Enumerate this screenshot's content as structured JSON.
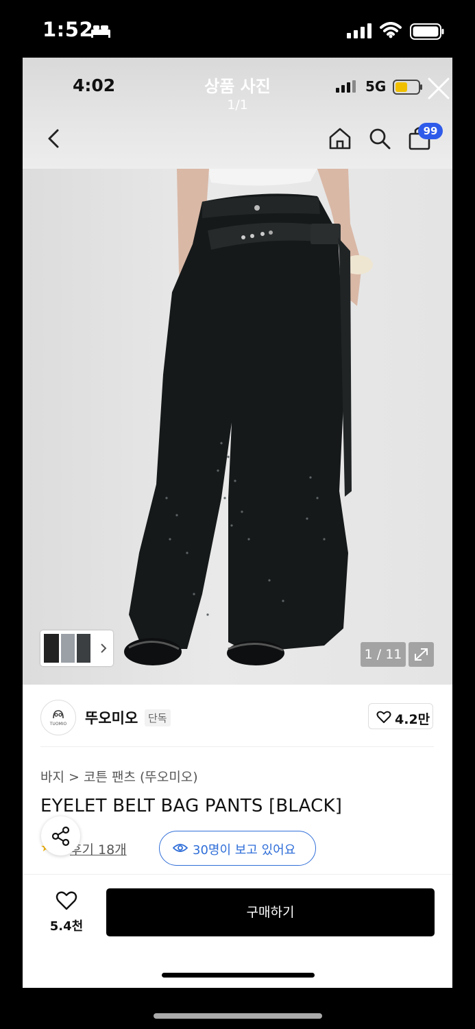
{
  "outer_status": {
    "time": "1:52"
  },
  "viewer": {
    "inner_time": "4:02",
    "title": "상품 사진",
    "count": "1/1",
    "network": "5G",
    "cart_badge": "99"
  },
  "product": {
    "image_page": "1 / 11",
    "brand": {
      "name": "뚜오미오",
      "logo_text": "TUOMIO",
      "badge": "단독",
      "likes": "4.2만"
    },
    "breadcrumb": "바지 > 코튼 팬츠 (뚜오미오)",
    "title": "EYELET BELT BAG PANTS [BLACK]",
    "review_link": "후기 18개",
    "viewer_notice": "30명이 보고 있어요"
  },
  "bottom_bar": {
    "wish_count": "5.4천",
    "buy_label": "구매하기"
  },
  "colors": {
    "accent_blue": "#2f6ed8",
    "badge_blue": "#2f5bea",
    "star": "#f5b400"
  }
}
